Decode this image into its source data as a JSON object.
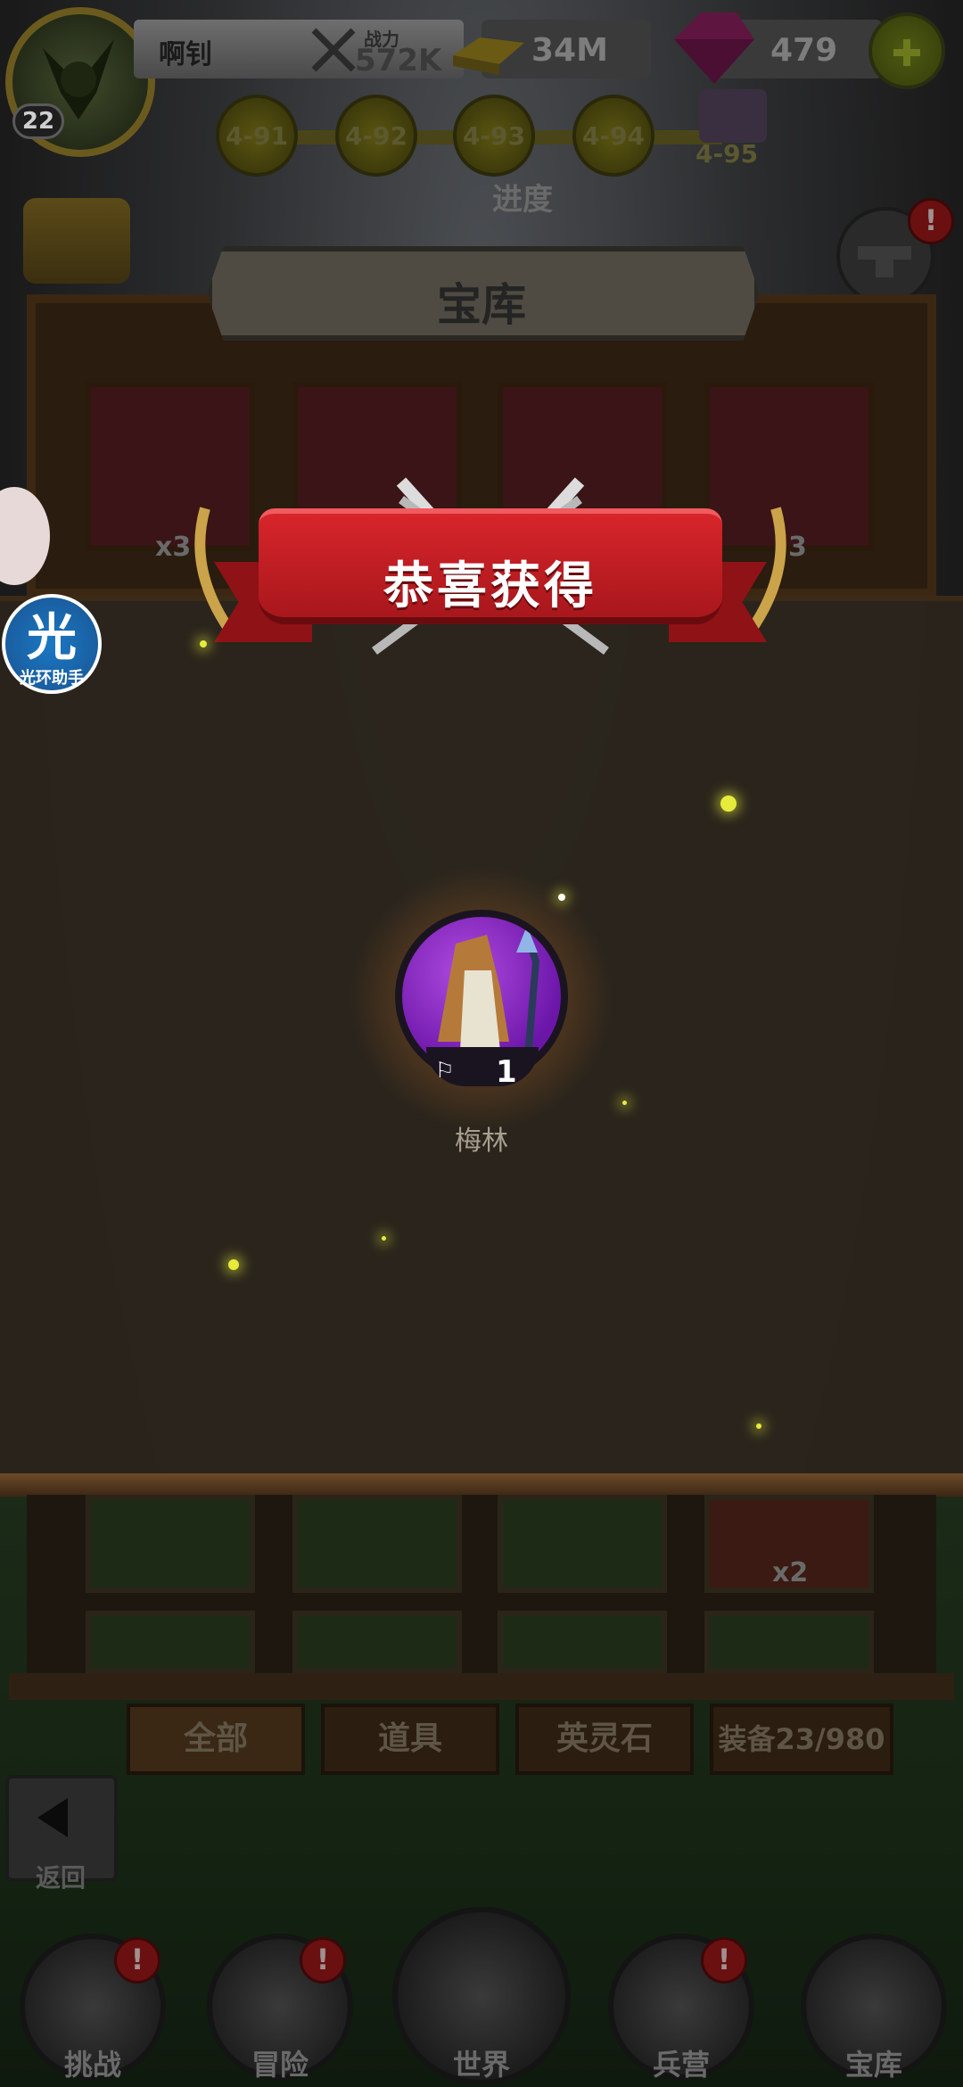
{
  "player": {
    "name": "啊钊",
    "level": "22",
    "power_label": "战力",
    "power_value": "572K",
    "gold": "34M",
    "gems": "479"
  },
  "progress": {
    "nodes": [
      "4-91",
      "4-92",
      "4-93",
      "4-94",
      "4-95"
    ],
    "label": "进度"
  },
  "vault": {
    "title": "宝库",
    "slot_counts": [
      "x3",
      "3"
    ]
  },
  "reward": {
    "banner": "恭喜获得",
    "hero_name": "梅林",
    "count": "1"
  },
  "halo_assistant": {
    "big": "光",
    "small": "光环助手"
  },
  "inventory": {
    "lower_count": "x2",
    "tabs": [
      "全部",
      "道具",
      "英灵石",
      "装备23/980"
    ]
  },
  "back_label": "返回",
  "nav": {
    "items": [
      "挑战",
      "冒险",
      "世界",
      "兵营",
      "宝库"
    ],
    "alert": "!"
  },
  "colors": {
    "ribbon": "#d7252b",
    "hero_bg": "#6b16a8",
    "sparkle": "#e7ec3c"
  }
}
